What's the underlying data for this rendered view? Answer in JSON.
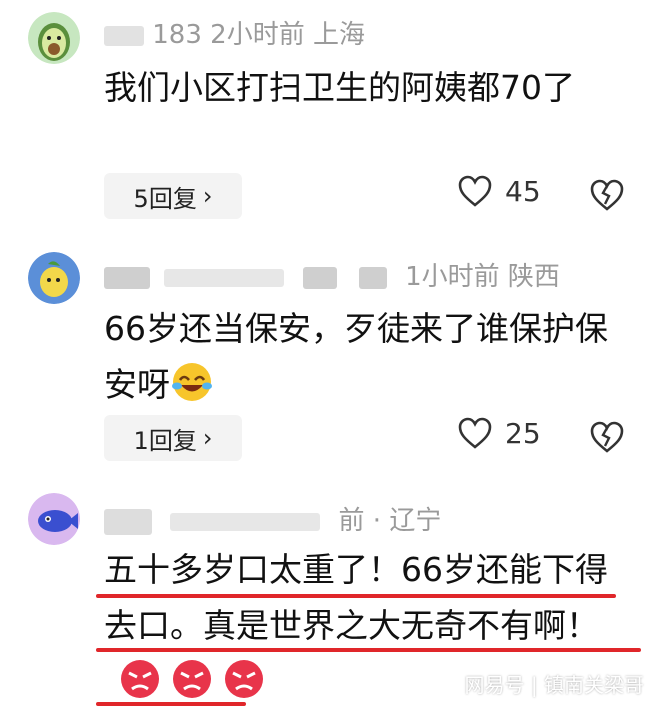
{
  "comments": [
    {
      "meta_visible": "183  2小时前  上海",
      "text": "我们小区打扫卫生的阿姨都70了",
      "replies": "5回复",
      "likes": "45"
    },
    {
      "meta_visible": "1小时前  陕西",
      "text": "66岁还当保安，歹徒来了谁保护保安呀",
      "replies": "1回复",
      "likes": "25"
    },
    {
      "meta_visible": "前 · 辽宁",
      "text": "五十多岁口太重了！66岁还能下得去口。真是世界之大无奇不有啊！"
    }
  ],
  "watermark": "网易号 | 镇南关梁哥",
  "colors": {
    "accent": "#e0262a",
    "meta": "#9a9a9a",
    "pill": "#f3f3f3"
  }
}
